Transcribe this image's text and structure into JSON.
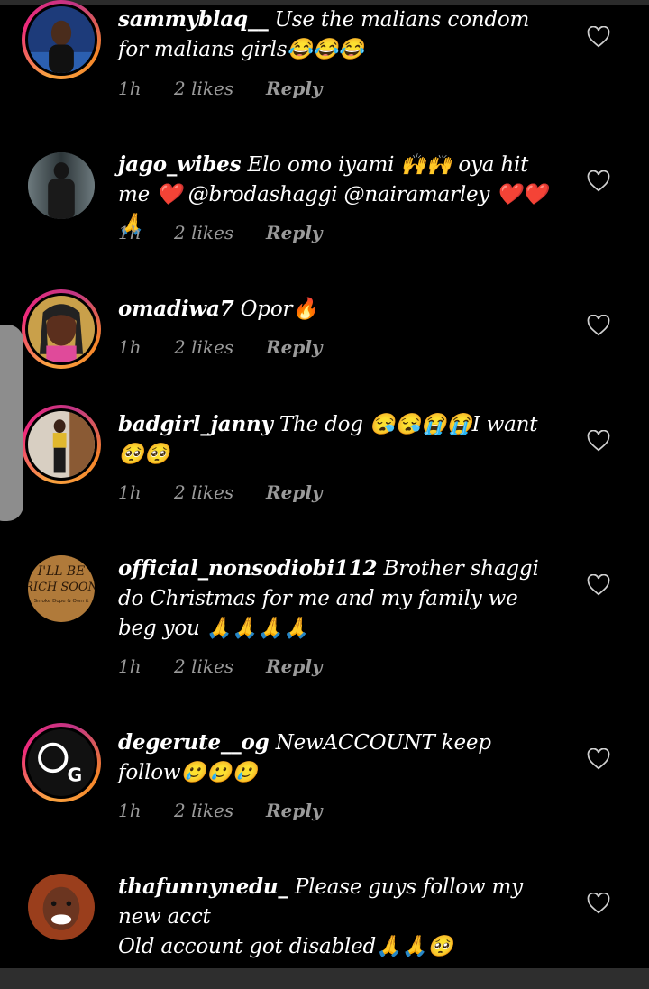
{
  "comments": [
    {
      "username": "sammyblaq__",
      "text": "Use the malians condom for malians girls😂😂😂",
      "time": "1h",
      "likes": "2 likes",
      "reply": "Reply"
    },
    {
      "username": "jago_wibes",
      "text": "Elo omo iyami 🙌🙌 oya hit me ❤️ @brodashaggi  @nairamarley ❤️❤️🙏",
      "time": "1h",
      "likes": "2 likes",
      "reply": "Reply"
    },
    {
      "username": "omadiwa7",
      "text": "Opor🔥",
      "time": "1h",
      "likes": "2 likes",
      "reply": "Reply"
    },
    {
      "username": "badgirl_janny",
      "text": "The dog 😪😪😭😭I want 🥺🥺",
      "time": "1h",
      "likes": "2 likes",
      "reply": "Reply"
    },
    {
      "username": "official_nonsodiobi112",
      "text": "Brother shaggi do Christmas for me and my family we beg you 🙏🙏🙏🙏",
      "time": "1h",
      "likes": "2 likes",
      "reply": "Reply"
    },
    {
      "username": "degerute__og",
      "text": "NewACCOUNT keep follow🥲🥲🥲",
      "time": "1h",
      "likes": "2 likes",
      "reply": "Reply"
    },
    {
      "username": "thafunnynedu_",
      "text": "Please guys follow my new acct\nOld account got disabled🙏🙏🥺",
      "time": "",
      "likes": "",
      "reply": ""
    }
  ],
  "avatars": {
    "c4_text": [
      "I'LL BE",
      "RICH SOON",
      "Smoke Dope & Own it"
    ],
    "c5_letter": "G"
  },
  "colors": {
    "background": "#000000",
    "meta": "#9a9a9a",
    "ring_start": "#f9a341",
    "ring_end": "#c13584"
  }
}
